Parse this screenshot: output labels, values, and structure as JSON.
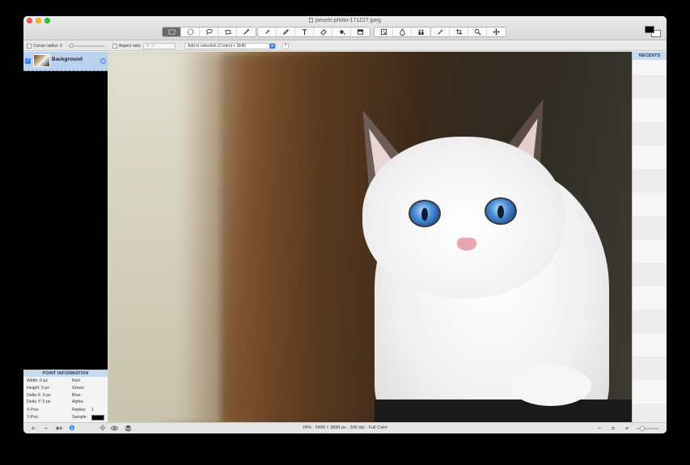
{
  "window": {
    "title": "pexels-photo-171227.jpeg"
  },
  "toolbar": {
    "groups": [
      [
        "rect-select-icon",
        "ellipse-select-icon",
        "lasso-icon",
        "polygon-lasso-icon",
        "magic-wand-icon"
      ],
      [
        "pen-icon",
        "pencil-icon",
        "text-icon",
        "eraser-icon",
        "paint-bucket-icon",
        "gradient-icon"
      ],
      [
        "crop-select-icon",
        "blur-drop-icon",
        "clone-stamp-icon"
      ],
      [
        "eyedropper-icon",
        "crop-icon",
        "zoom-icon",
        "move-icon"
      ]
    ]
  },
  "options": {
    "corner_radius_label": "Corner radius: 0",
    "aspect_ratio_label": "Aspect ratio:",
    "aspect_ratio_value": "4 : 3",
    "selection_mode": "Add to selection (Control + Shift)",
    "help_label": "?"
  },
  "layers": [
    {
      "name": "Background",
      "visible": true
    }
  ],
  "point_info": {
    "heading": "POINT INFORMATION",
    "width": "Width:   0 px",
    "height": "Height:  0 px",
    "delta_x": "Delta X: 0 px",
    "delta_y": "Delta Y: 0 px",
    "x_pos": "X-Pos:",
    "y_pos": "Y-Pos:",
    "red": "Red:",
    "green": "Green:",
    "blue": "Blue:",
    "alpha": "Alpha:",
    "radius": "Radius:",
    "radius_value": "1",
    "sample": "Sample:",
    "sample_color": "#000000"
  },
  "recents": {
    "heading": "RECENTS"
  },
  "status": {
    "info": "24% · 5499 × 3666 px · 300 dpi · Full Color",
    "add_label": "+",
    "remove_label": "−",
    "add_layer_label": "+",
    "zoom_out_label": "−",
    "zoom_fit_label": "=",
    "zoom_in_label": "+"
  },
  "colors": {
    "foreground": "#000000",
    "background": "#ffffff",
    "accent": "#3b82f6"
  }
}
